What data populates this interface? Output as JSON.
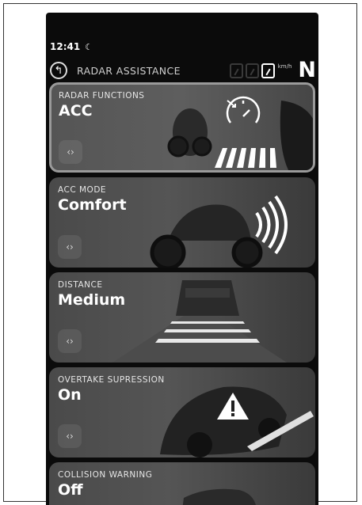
{
  "status": {
    "time": "12:41",
    "moon_icon": "moon-icon"
  },
  "topbar": {
    "title": "RADAR ASSISTANCE",
    "speed_unit": "km/h",
    "gear": "N"
  },
  "cards": [
    {
      "label": "RADAR FUNCTIONS",
      "value": "ACC",
      "toggle": "‹›"
    },
    {
      "label": "ACC MODE",
      "value": "Comfort",
      "toggle": "‹›"
    },
    {
      "label": "DISTANCE",
      "value": "Medium",
      "toggle": "‹›"
    },
    {
      "label": "OVERTAKE SUPRESSION",
      "value": "On",
      "toggle": "‹›"
    },
    {
      "label": "COLLISION WARNING",
      "value": "Off"
    }
  ]
}
